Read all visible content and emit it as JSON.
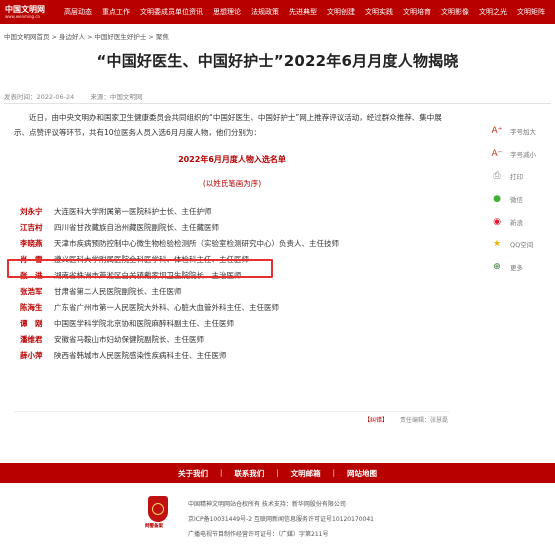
{
  "header": {
    "logo_text": "中国文明网",
    "logo_url": "www.wenming.cn",
    "nav": [
      "高层动态",
      "重点工作",
      "文明委成员单位资讯",
      "思想理论",
      "法规政策",
      "先进典型",
      "文明创建",
      "文明实践",
      "文明培育",
      "文明影像",
      "文明之光",
      "文明矩阵"
    ]
  },
  "breadcrumb": [
    "中国文明网首页",
    ">",
    "身边好人",
    ">",
    "中国好医生好护士",
    ">",
    "聚焦"
  ],
  "article": {
    "title": "“中国好医生、中国好护士”2022年6月月度人物揭晓",
    "publish_time": "发表时间：2022-06-24",
    "source": "来源：中国文明网",
    "intro": "近日，由中央文明办和国家卫生健康委员会共同组织的“中国好医生、中国好护士”网上推荐评议活动，经过群众推荐、集中展示、点赞评议等环节，共有10位医务人员入选6月月度人物，他们分别为：",
    "list_heading": "2022年6月月度人物入选名单",
    "list_subheading": "(以姓氏笔画为序)",
    "people": [
      {
        "name": "刘永宁",
        "desc": "大连医科大学附属第一医院科护士长、主任护师"
      },
      {
        "name": "江吉村",
        "desc": "四川省甘孜藏族自治州藏医院副院长、主任藏医师"
      },
      {
        "name": "李晓燕",
        "desc": "天津市疾病预防控制中心微生物检验检测所（实验室检测研究中心）负责人、主任技师"
      },
      {
        "name": "肖　雪",
        "desc": "遵义医科大学附属医院全科医学科、体检科主任、主任医师"
      },
      {
        "name": "张　进",
        "desc": "湖南省株洲市芦淞区白关镇戴家坝卫生院院长、主治医师"
      },
      {
        "name": "张浩军",
        "desc": "甘肃省第二人民医院副院长、主任医师"
      },
      {
        "name": "陈海生",
        "desc": "广东省广州市第一人民医院大外科、心脏大血管外科主任、主任医师"
      },
      {
        "name": "谭　刚",
        "desc": "中国医学科学院北京协和医院麻醉科副主任、主任医师"
      },
      {
        "name": "潘维君",
        "desc": "安徽省马鞍山市妇幼保健院副院长、主任医师"
      },
      {
        "name": "薛小萍",
        "desc": "陕西省韩城市人民医院感染性疾病科主任、主任医师"
      }
    ],
    "correction": "【纠错】",
    "editor": "责任编辑：张慧磊"
  },
  "side_panel": [
    {
      "label": "字号加大",
      "icon": "font-larger-icon",
      "glyph": "A⁺",
      "color": "#c0392b"
    },
    {
      "label": "字号减小",
      "icon": "font-smaller-icon",
      "glyph": "A⁻",
      "color": "#c0392b"
    },
    {
      "label": "打印",
      "icon": "print-icon",
      "glyph": "⎙",
      "color": "#888888"
    },
    {
      "label": "微信",
      "icon": "wechat-icon",
      "glyph": "●",
      "color": "#3eb135"
    },
    {
      "label": "新浪",
      "icon": "weibo-icon",
      "glyph": "◉",
      "color": "#e6162d"
    },
    {
      "label": "QQ空间",
      "icon": "qzone-icon",
      "glyph": "★",
      "color": "#f5b400"
    },
    {
      "label": "更多",
      "icon": "more-icon",
      "glyph": "⊕",
      "color": "#2e7d32"
    }
  ],
  "footer": {
    "links": [
      "关于我们",
      "联系我们",
      "文明邮箱",
      "网站地图"
    ],
    "emblem_label": "网警备案",
    "info": [
      "中国精神文明网站仓权所有   技术支持：新华网股份有限公司",
      "京ICP备10031449号-2  互联网新闻信息服务许可证号10120170041",
      "广播电视节目制作经营许可证号：（广媒）字第211号"
    ]
  }
}
